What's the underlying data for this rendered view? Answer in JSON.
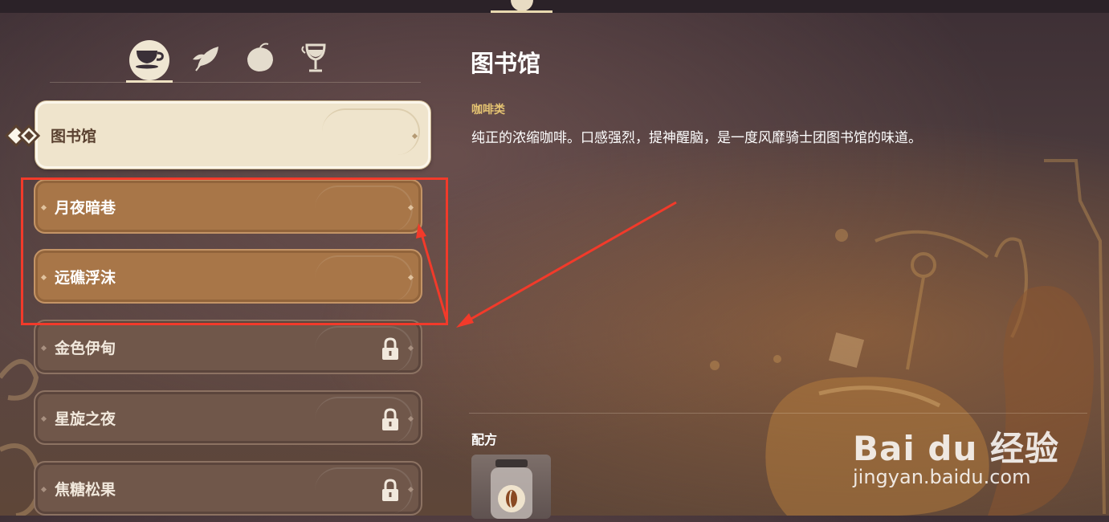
{
  "category_tabs": [
    {
      "name": "coffee",
      "icon": "teacup-icon",
      "active": true
    },
    {
      "name": "tea",
      "icon": "leaf-icon",
      "active": false
    },
    {
      "name": "fruit",
      "icon": "fruit-icon",
      "active": false
    },
    {
      "name": "wine",
      "icon": "goblet-icon",
      "active": false
    }
  ],
  "recipes": [
    {
      "label": "图书馆",
      "state": "selected"
    },
    {
      "label": "月夜暗巷",
      "state": "unlocked"
    },
    {
      "label": "远礁浮沫",
      "state": "unlocked"
    },
    {
      "label": "金色伊甸",
      "state": "locked"
    },
    {
      "label": "星旋之夜",
      "state": "locked"
    },
    {
      "label": "焦糖松果",
      "state": "locked"
    }
  ],
  "detail": {
    "title": "图书馆",
    "category": "咖啡类",
    "description": "纯正的浓缩咖啡。口感强烈，提神醒脑，是一度风靡骑士团图书馆的味道。",
    "recipe_label": "配方",
    "recipe_item_icon": "coffee-bean-jar-icon"
  },
  "watermark": {
    "logo_text": "Bai du 经验",
    "url": "jingyan.baidu.com"
  },
  "colors": {
    "highlight": "#f23a2a",
    "selected_item": "#efe4cc",
    "unlocked_item": "#a87648",
    "locked_item": "#70574a",
    "category_text": "#e4c372"
  }
}
